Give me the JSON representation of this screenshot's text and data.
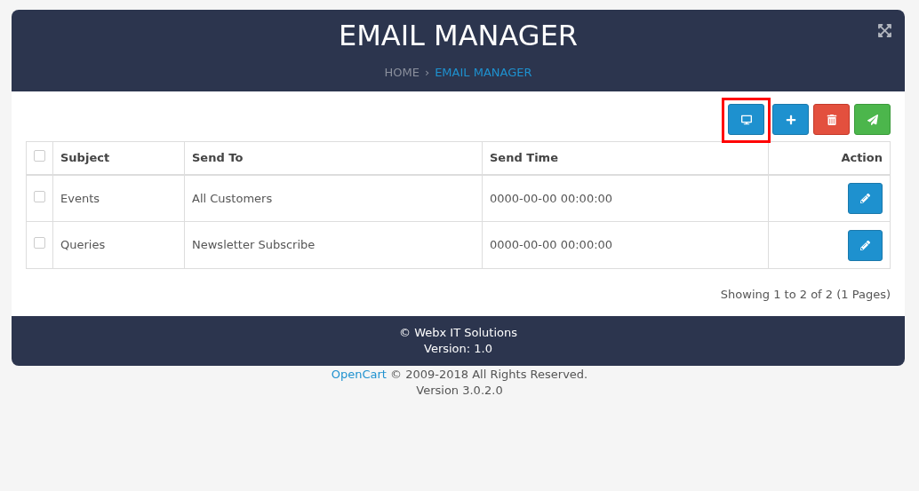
{
  "header": {
    "title": "EMAIL MANAGER",
    "breadcrumb": [
      {
        "label": "HOME",
        "selected": false
      },
      {
        "label": "EMAIL MANAGER",
        "selected": true
      }
    ],
    "breadcrumb_separator": "›"
  },
  "toolbar": [
    {
      "kind": "view",
      "highlighted": true
    },
    {
      "kind": "add",
      "highlighted": false
    },
    {
      "kind": "delete",
      "highlighted": false
    },
    {
      "kind": "send",
      "highlighted": false
    }
  ],
  "table": {
    "columns": [
      "Subject",
      "Send To",
      "Send Time",
      "Action"
    ],
    "select_all_checked": false,
    "rows": [
      {
        "checked": false,
        "subject": "Events",
        "send_to": "All Customers",
        "send_time": "0000-00-00 00:00:00"
      },
      {
        "checked": false,
        "subject": "Queries",
        "send_to": "Newsletter Subscribe",
        "send_time": "0000-00-00 00:00:00"
      }
    ]
  },
  "pagination": "Showing 1 to 2 of 2 (1 Pages)",
  "footer": {
    "company": "© Webx IT Solutions",
    "version": "Version: 1.0"
  },
  "page_footer": {
    "link": "OpenCart",
    "text": "© 2009-2018 All Rights Reserved.",
    "version": "Version 3.0.2.0"
  }
}
